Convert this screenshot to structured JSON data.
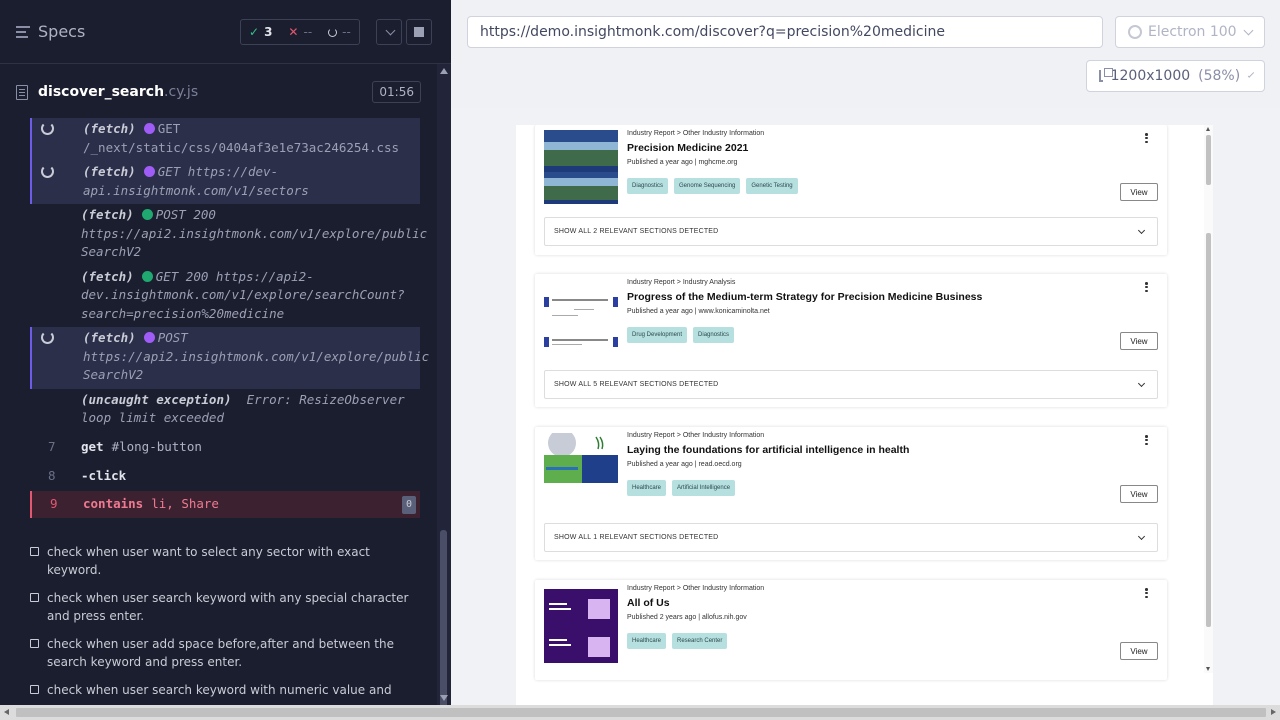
{
  "specs_header": {
    "title": "Specs",
    "passed": "3",
    "failed": "--",
    "pending": "--"
  },
  "file": {
    "name": "discover_search",
    "ext": ".cy.js",
    "duration": "01:56"
  },
  "log": [
    {
      "state": "pending",
      "name": "(fetch)",
      "method": "GET",
      "url": "/_next/static/css/0404af3e1e73ac246254.css"
    },
    {
      "state": "pending",
      "name": "(fetch)",
      "method": "GET https://dev-",
      "url": "api.insightmonk.com/v1/sectors"
    },
    {
      "state": "done",
      "name": "(fetch)",
      "method": "POST 200",
      "url": "https://api2.insightmonk.com/v1/explore/public",
      "url2": "SearchV2"
    },
    {
      "state": "done",
      "name": "(fetch)",
      "method": "GET 200 https://api2-",
      "url": "dev.insightmonk.com/v1/explore/searchCount?",
      "url2": "search=precision%20medicine"
    },
    {
      "state": "pending",
      "name": "(fetch)",
      "method": "POST",
      "url": "https://api2.insightmonk.com/v1/explore/public",
      "url2": "SearchV2"
    },
    {
      "name": "(uncaught exception)",
      "msg": "Error: ResizeObserver",
      "msg2": "loop limit exceeded"
    }
  ],
  "commands": [
    {
      "num": "7",
      "name": "get",
      "arg": "#long-button"
    },
    {
      "num": "8",
      "name": "-click",
      "arg": ""
    },
    {
      "num": "9",
      "name": "contains",
      "arg": "li, Share",
      "badge": "0"
    }
  ],
  "tests": [
    "check when user want to select any sector with exact keyword.",
    "check when user search keyword with any special character and press enter.",
    "check when user add space before,after and between the search keyword and press enter.",
    "check when user search keyword with numeric value and"
  ],
  "toolbar": {
    "url": "https://demo.insightmonk.com/discover?q=precision%20medicine",
    "browser": "Electron 100",
    "viewport": "1200x1000",
    "zoom": "(58%)"
  },
  "results": [
    {
      "crumb": "Industry Report > Other Industry Information",
      "title": "Precision Medicine 2021",
      "published": "Published a year ago | mghcme.org",
      "tags": [
        "Diagnostics",
        "Genome Sequencing",
        "Genetic Testing"
      ],
      "view": "View",
      "sections": "SHOW ALL 2 RELEVANT SECTIONS DETECTED"
    },
    {
      "crumb": "Industry Report > Industry Analysis",
      "title": "Progress of the Medium-term Strategy for Precision Medicine Business",
      "published": "Published a year ago | www.konicaminolta.net",
      "tags": [
        "Drug Development",
        "Diagnostics"
      ],
      "view": "View",
      "sections": "SHOW ALL 5 RELEVANT SECTIONS DETECTED"
    },
    {
      "crumb": "Industry Report > Other Industry Information",
      "title": "Laying the foundations for artificial intelligence in health",
      "published": "Published a year ago | read.oecd.org",
      "tags": [
        "Healthcare",
        "Artificial Intelligence"
      ],
      "view": "View",
      "sections": "SHOW ALL 1 RELEVANT SECTIONS DETECTED"
    },
    {
      "crumb": "Industry Report > Other Industry Information",
      "title": "All of Us",
      "published": "Published 2 years ago | allofus.nih.gov",
      "tags": [
        "Healthcare",
        "Research Center"
      ],
      "view": "View"
    }
  ]
}
